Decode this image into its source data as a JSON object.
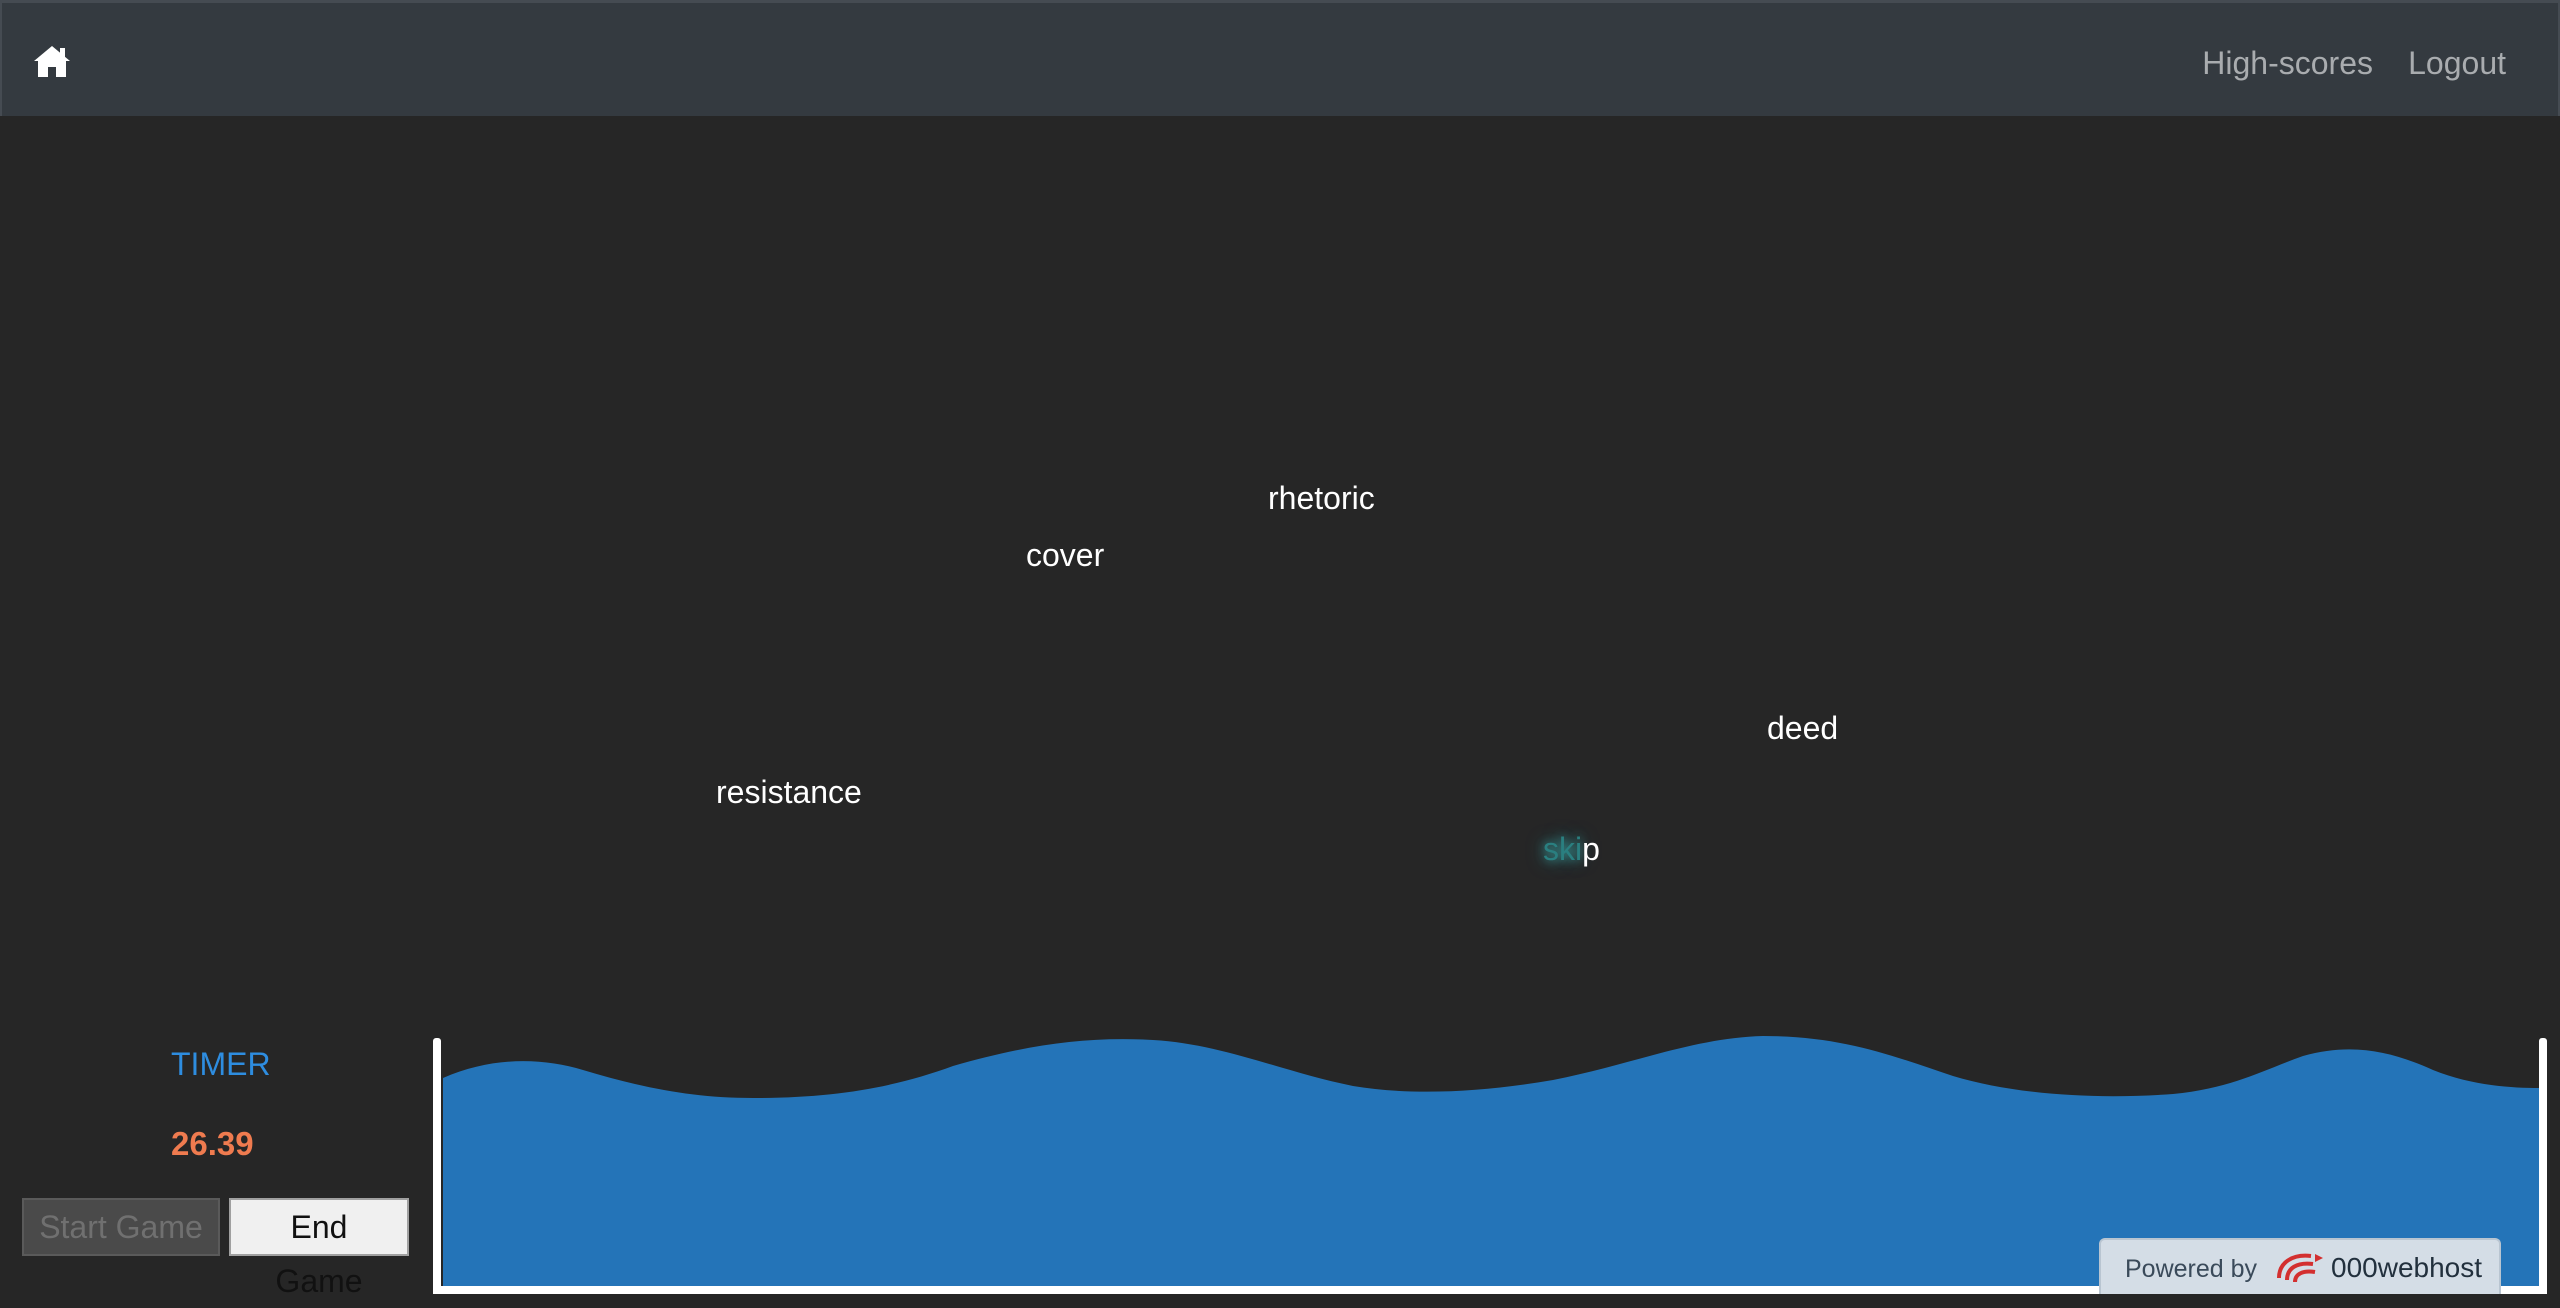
{
  "nav": {
    "home_icon": "home-icon",
    "links": [
      "High-scores",
      "Logout"
    ]
  },
  "words": [
    {
      "text": "rhetoric",
      "typed": ""
    },
    {
      "text": "cover",
      "typed": ""
    },
    {
      "text": "deed",
      "typed": ""
    },
    {
      "text": "resistance",
      "typed": ""
    },
    {
      "text": "skip",
      "typed": "ski",
      "rest": "p"
    }
  ],
  "timer": {
    "label": "TIMER",
    "value": "26.39"
  },
  "buttons": {
    "start": "Start Game",
    "end": "End Game"
  },
  "footer": {
    "powered_by": "Powered by",
    "brand": "000webhost"
  },
  "colors": {
    "background": "#262626",
    "navbar": "#343a40",
    "water": "#2474b8",
    "timer_label": "#2e8de0",
    "timer_value": "#ef7b4f",
    "typed_letters": "#2a7f80"
  }
}
